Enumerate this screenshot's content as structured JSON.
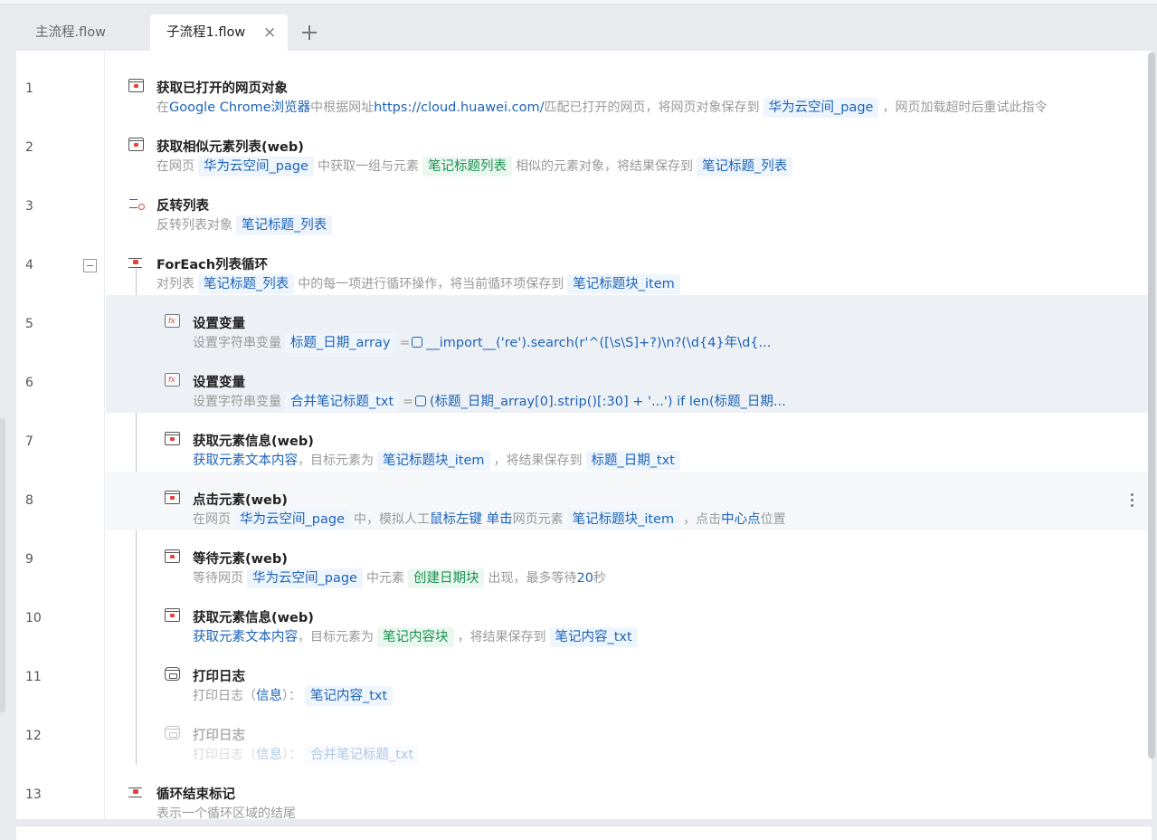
{
  "tabs": [
    {
      "label": "主流程.flow",
      "active": false
    },
    {
      "label": "子流程1.flow",
      "active": true,
      "close": "×"
    }
  ],
  "steps": [
    {
      "num": "1",
      "icon": "webpage-icon",
      "title": "获取已打开的网页对象",
      "desc": [
        {
          "t": "在 "
        },
        {
          "t": "Google Chrome浏览器",
          "k": "link"
        },
        {
          "t": " 中根据网址 "
        },
        {
          "t": "https://cloud.huawei.com/",
          "k": "link"
        },
        {
          "t": " 匹配已打开的网页，将网页对象保存到 "
        },
        {
          "t": "华为云空间_page",
          "k": "tag"
        },
        {
          "t": "，网页加载超时后重试此指令"
        }
      ]
    },
    {
      "num": "2",
      "icon": "similar-elements-icon",
      "title": "获取相似元素列表(web)",
      "desc": [
        {
          "t": "在网页 "
        },
        {
          "t": "华为云空间_page",
          "k": "tag"
        },
        {
          "t": "中获取一组与元素 "
        },
        {
          "t": "笔记标题列表",
          "k": "green"
        },
        {
          "t": "相似的元素对象，将结果保存到 "
        },
        {
          "t": "笔记标题_列表",
          "k": "tag"
        }
      ]
    },
    {
      "num": "3",
      "icon": "reverse-list-icon",
      "title": "反转列表",
      "desc": [
        {
          "t": "反转列表对象 "
        },
        {
          "t": "笔记标题_列表",
          "k": "tag"
        }
      ]
    },
    {
      "num": "4",
      "icon": "loop-icon",
      "title": "ForEach列表循环",
      "desc": [
        {
          "t": "对列表 "
        },
        {
          "t": "笔记标题_列表",
          "k": "tag"
        },
        {
          "t": "中的每一项进行循环操作，将当前循环项保存到 "
        },
        {
          "t": "笔记标题块_item",
          "k": "tag"
        }
      ]
    },
    {
      "num": "5",
      "icon": "set-variable-icon",
      "title": "设置变量",
      "indent": true,
      "state": "sel",
      "desc": [
        {
          "t": "设置字符串变量 "
        },
        {
          "t": "标题_日期_array",
          "k": "tag"
        },
        {
          "t": " = "
        },
        {
          "t": "__import__('re').search(r'^([\\s\\S]+?)\\n?(\\d{4}年\\d{...",
          "k": "py"
        }
      ]
    },
    {
      "num": "6",
      "icon": "set-variable-icon",
      "title": "设置变量",
      "indent": true,
      "state": "sel",
      "desc": [
        {
          "t": "设置字符串变量 "
        },
        {
          "t": "合并笔记标题_txt",
          "k": "tag"
        },
        {
          "t": " = "
        },
        {
          "t": "(标题_日期_array[0].strip()[:30] + '...') if len(标题_日期...",
          "k": "py"
        }
      ]
    },
    {
      "num": "7",
      "icon": "get-element-info-icon",
      "title": "获取元素信息(web)",
      "indent": true,
      "desc": [
        {
          "t": "获取元素文本内容",
          "k": "link"
        },
        {
          "t": "，目标元素为 "
        },
        {
          "t": "笔记标题块_item",
          "k": "tag"
        },
        {
          "t": "，将结果保存到 "
        },
        {
          "t": "标题_日期_txt",
          "k": "tag"
        }
      ]
    },
    {
      "num": "8",
      "icon": "click-element-icon",
      "title": "点击元素(web)",
      "indent": true,
      "state": "hover",
      "desc": [
        {
          "t": "在网页 "
        },
        {
          "t": "华为云空间_page",
          "k": "tag"
        },
        {
          "t": "中，模拟人工 "
        },
        {
          "t": "鼠标左键 单击",
          "k": "link"
        },
        {
          "t": " 网页元素 "
        },
        {
          "t": "笔记标题块_item",
          "k": "tag"
        },
        {
          "t": "，点击 "
        },
        {
          "t": "中心点",
          "k": "link"
        },
        {
          "t": " 位置"
        }
      ]
    },
    {
      "num": "9",
      "icon": "wait-element-icon",
      "title": "等待元素(web)",
      "indent": true,
      "desc": [
        {
          "t": "等待网页 "
        },
        {
          "t": "华为云空间_page",
          "k": "tag"
        },
        {
          "t": "中元素 "
        },
        {
          "t": "创建日期块",
          "k": "green"
        },
        {
          "t": "出现，最多等待 "
        },
        {
          "t": "20",
          "k": "link"
        },
        {
          "t": " 秒"
        }
      ]
    },
    {
      "num": "10",
      "icon": "get-element-info-icon",
      "title": "获取元素信息(web)",
      "indent": true,
      "desc": [
        {
          "t": "获取元素文本内容",
          "k": "link"
        },
        {
          "t": "，目标元素为 "
        },
        {
          "t": "笔记内容块",
          "k": "green"
        },
        {
          "t": "，将结果保存到 "
        },
        {
          "t": "笔记内容_txt",
          "k": "tag"
        }
      ]
    },
    {
      "num": "11",
      "icon": "print-log-icon",
      "title": "打印日志",
      "indent": true,
      "desc": [
        {
          "t": "打印日志（"
        },
        {
          "t": "信息",
          "k": "link"
        },
        {
          "t": "）："
        },
        {
          "t": "笔记内容_txt",
          "k": "tag"
        }
      ]
    },
    {
      "num": "12",
      "icon": "print-log-icon",
      "title": "打印日志",
      "indent": true,
      "state": "disabled",
      "desc": [
        {
          "t": "打印日志（"
        },
        {
          "t": "信息",
          "k": "link"
        },
        {
          "t": "）："
        },
        {
          "t": "合并笔记标题_txt",
          "k": "tag"
        }
      ]
    },
    {
      "num": "13",
      "icon": "loop-end-icon",
      "title": "循环结束标记",
      "desc": [
        {
          "t": "表示一个循环区域的结尾"
        }
      ]
    }
  ]
}
